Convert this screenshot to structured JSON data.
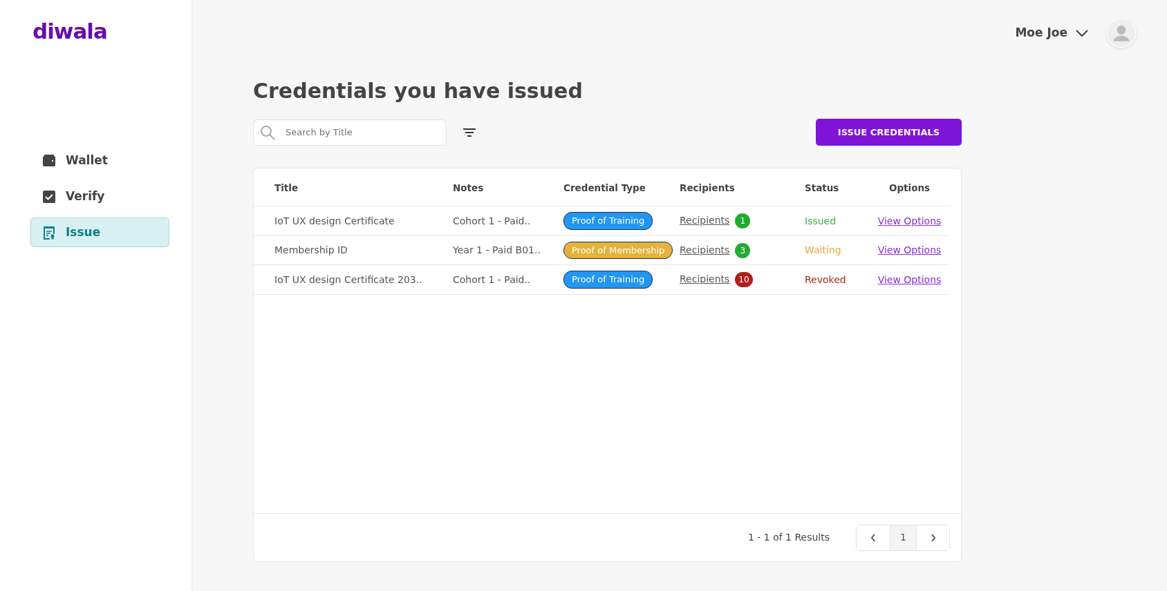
{
  "logo": "diwala",
  "sidebar": {
    "items": [
      {
        "label": "Wallet",
        "kind": "wallet",
        "selected": false
      },
      {
        "label": "Verify",
        "kind": "verify",
        "selected": false
      },
      {
        "label": "Issue",
        "kind": "issue",
        "selected": true
      }
    ]
  },
  "user": {
    "name": "Moe Joe"
  },
  "page_title": "Credentials you have issued",
  "search": {
    "placeholder": "Search by Title"
  },
  "issue_button": "ISSUE CREDENTIALS",
  "table": {
    "columns": [
      "Title",
      "Notes",
      "Credential Type",
      "Recipients",
      "Status",
      "Options"
    ],
    "rows": [
      {
        "title": "IoT UX design Certificate",
        "notes": "Cohort 1 - Paid..",
        "type": {
          "label": "Proof of Training",
          "color": "#2196f3"
        },
        "recipients": {
          "label": "Recipients",
          "count": "1",
          "color": "#22aa33"
        },
        "status": {
          "label": "Issued",
          "color": "#3cae4b"
        },
        "options": "View Options"
      },
      {
        "title": "Membership ID",
        "notes": "Year 1 - Paid B01..",
        "type": {
          "label": "Proof of Membership",
          "color": "#e3b33b"
        },
        "recipients": {
          "label": "Recipients",
          "count": "3",
          "color": "#22aa33"
        },
        "status": {
          "label": "Waiting",
          "color": "#e8a93a"
        },
        "options": "View Options"
      },
      {
        "title": "IoT UX design Certificate 203..",
        "notes": "Cohort 1 - Paid..",
        "type": {
          "label": "Proof of Training",
          "color": "#2196f3"
        },
        "recipients": {
          "label": "Recipients",
          "count": "10",
          "color": "#b01e1e"
        },
        "status": {
          "label": "Revoked",
          "color": "#a82a1a"
        },
        "options": "View Options"
      }
    ]
  },
  "pagination": {
    "summary": "1 - 1 of 1 Results",
    "pages": [
      {
        "label": "1",
        "selected": true
      }
    ]
  }
}
